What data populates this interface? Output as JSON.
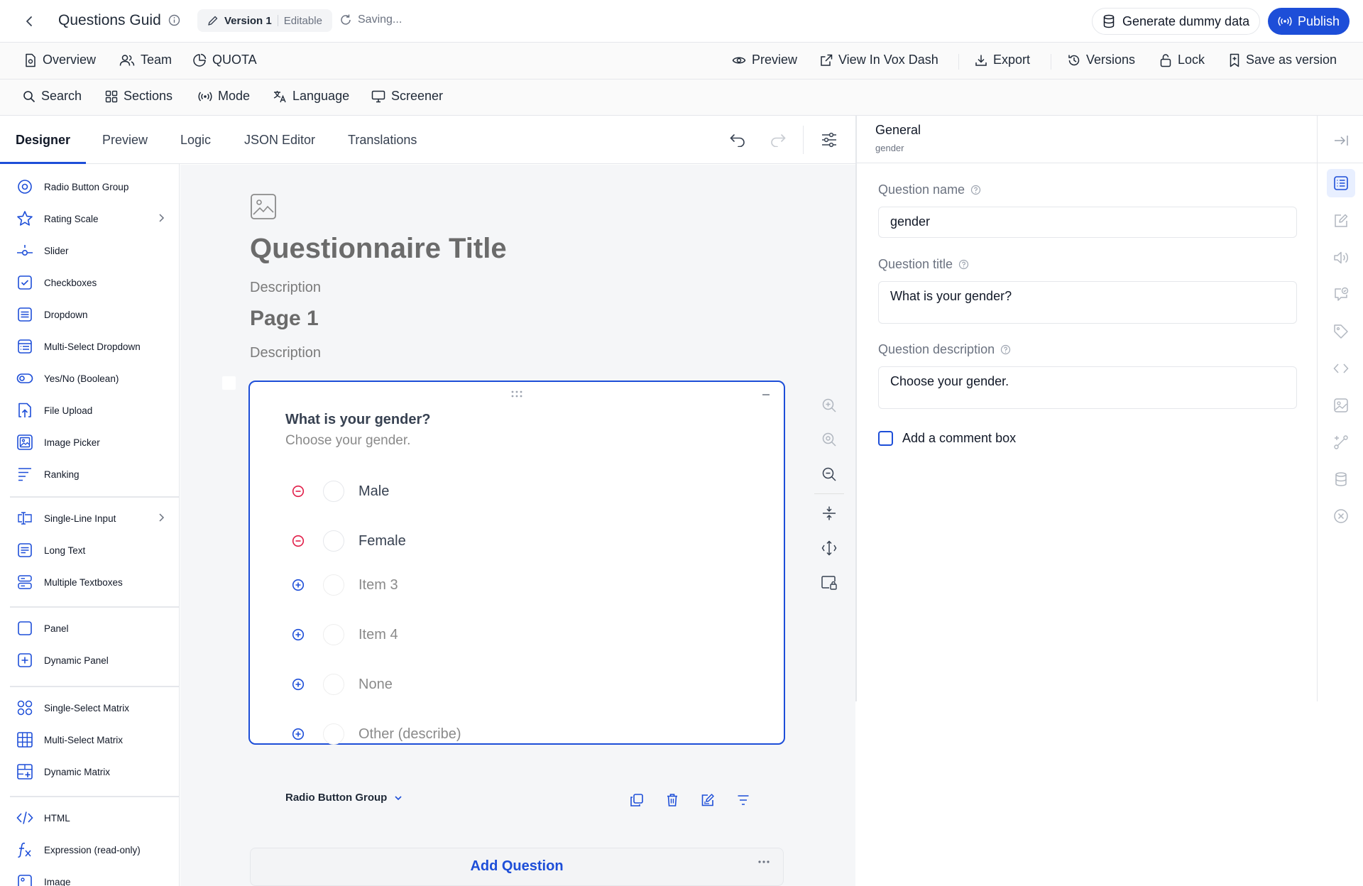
{
  "topbar": {
    "title": "Questions Guid",
    "version_label": "Version 1",
    "version_state": "Editable",
    "status": "Saving...",
    "generate_label": "Generate dummy data",
    "publish_label": "Publish"
  },
  "nav": {
    "overview": "Overview",
    "team": "Team",
    "quota": "QUOTA",
    "preview": "Preview",
    "view_in_vox": "View In Vox Dash",
    "export": "Export",
    "versions": "Versions",
    "lock": "Lock",
    "save_version": "Save as version"
  },
  "tools": {
    "search": "Search",
    "sections": "Sections",
    "mode": "Mode",
    "language": "Language",
    "screener": "Screener"
  },
  "tabs": [
    "Designer",
    "Preview",
    "Logic",
    "JSON Editor",
    "Translations"
  ],
  "toolbox": [
    "Radio Button Group",
    "Rating Scale",
    "Slider",
    "Checkboxes",
    "Dropdown",
    "Multi-Select Dropdown",
    "Yes/No (Boolean)",
    "File Upload",
    "Image Picker",
    "Ranking",
    "Single-Line Input",
    "Long Text",
    "Multiple Textboxes",
    "Panel",
    "Dynamic Panel",
    "Single-Select Matrix",
    "Multi-Select Matrix",
    "Dynamic Matrix",
    "HTML",
    "Expression (read-only)",
    "Image"
  ],
  "canvas": {
    "survey_title": "Questionnaire Title",
    "survey_description": "Description",
    "page_title": "Page 1",
    "page_description": "Description",
    "question": {
      "title": "What is your gender?",
      "description": "Choose your gender.",
      "choices": [
        "Male",
        "Female"
      ],
      "placeholder_choices": [
        "Item 3",
        "Item 4",
        "None",
        "Other (describe)"
      ],
      "type_label": "Radio Button Group"
    },
    "add_question": "Add Question"
  },
  "props": {
    "section_title": "General",
    "section_sub": "gender",
    "name_label": "Question name",
    "name_value": "gender",
    "title_label": "Question title",
    "title_value": "What is your gender?",
    "description_label": "Question description",
    "description_value": "Choose your gender.",
    "comment_label": "Add a comment box"
  },
  "colors": {
    "accent": "#1d4ed8",
    "remove": "#e11d48"
  }
}
